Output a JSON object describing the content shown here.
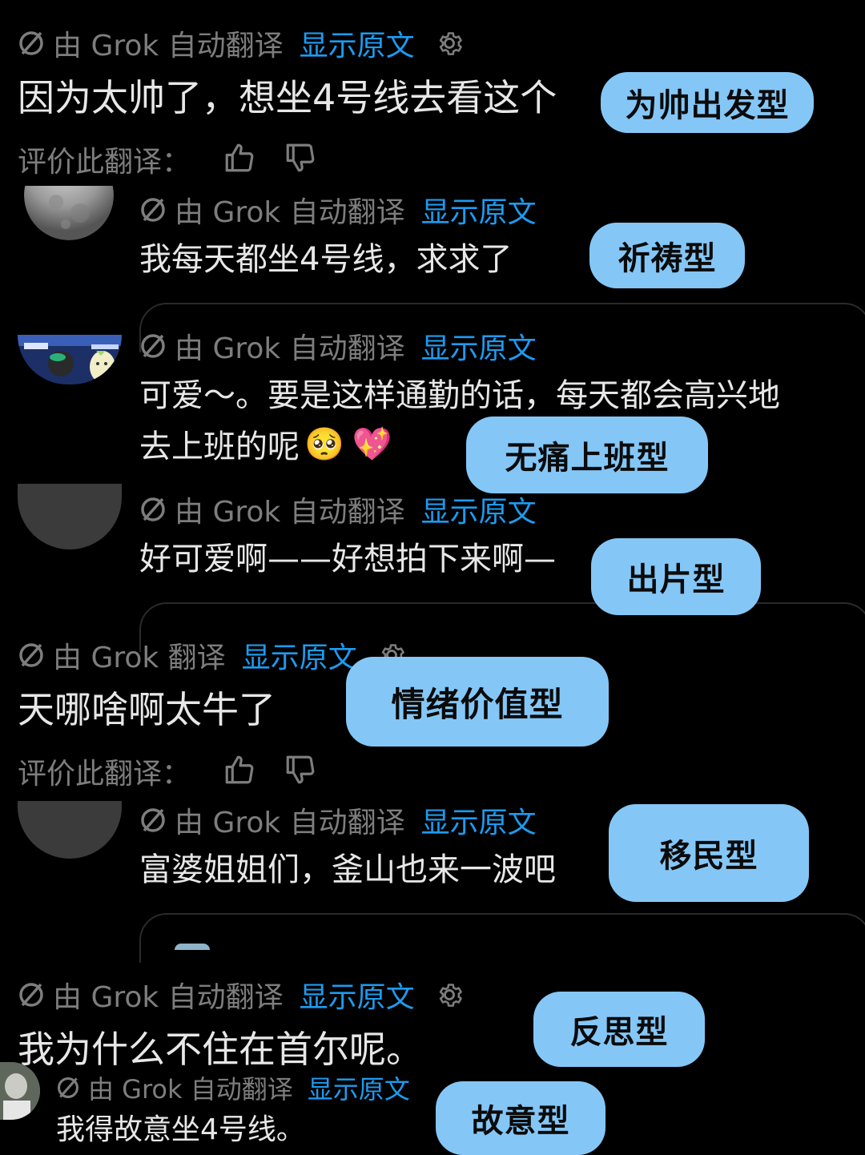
{
  "auto_label": "由 Grok 自动翻译",
  "plain_label": "由 Grok 翻译",
  "show_original": "显示原文",
  "rate_label": "评价此翻译：",
  "c1": {
    "text": "因为太帅了，想坐4号线去看这个",
    "tag": "为帅出发型"
  },
  "c2": {
    "text": "我每天都坐4号线，求求了",
    "tag": "祈祷型"
  },
  "c3": {
    "line1": "可爱～。要是这样通勤的话，每天都会高兴地",
    "line2": "去上班的呢",
    "tag": "无痛上班型"
  },
  "c4": {
    "text": "好可爱啊——好想拍下来啊—",
    "tag": "出片型"
  },
  "c5": {
    "text": "天哪啥啊太牛了",
    "tag": "情绪价值型"
  },
  "c6": {
    "text": "富婆姐姐们，釜山也来一波吧",
    "tag": "移民型"
  },
  "c7": {
    "text": "我为什么不住在首尔呢。",
    "tag": "反思型"
  },
  "c8": {
    "text": "我得故意坐4号线。",
    "tag": "故意型"
  },
  "emoji": {
    "pleading": "🥺",
    "sparkle_heart": "💖"
  },
  "colors": {
    "link": "#1d9bf0",
    "tag_bg": "#84c7f7",
    "meta": "#7d7d7d",
    "bg": "#000000"
  }
}
